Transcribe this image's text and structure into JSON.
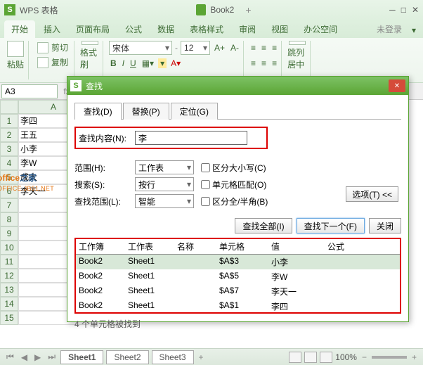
{
  "titlebar": {
    "title": "WPS 表格",
    "doc": "Book2",
    "plus": "+"
  },
  "menus": {
    "items": [
      "开始",
      "插入",
      "页面布局",
      "公式",
      "数据",
      "表格样式",
      "审阅",
      "视图",
      "办公空间"
    ],
    "login": "未登录",
    "drop": "▾"
  },
  "ribbon": {
    "cut": "剪切",
    "copy": "复制",
    "paste": "粘贴",
    "fmt": "格式刷",
    "font": "宋体",
    "size": "12",
    "aplus": "A+",
    "aminus": "A-",
    "fill": "跳列居中"
  },
  "cellref": "A3",
  "colA": "A",
  "cells": [
    "李四",
    "王五",
    "小李",
    "李W",
    "成大",
    "李天一",
    "",
    "",
    "",
    "",
    "",
    "",
    "",
    "",
    ""
  ],
  "watermark": {
    "t1": "office",
    "t2": "之家",
    "t3": "OFFICE.JB51.NET"
  },
  "dialog": {
    "title": "查找",
    "tabs": [
      "查找(D)",
      "替换(P)",
      "定位(G)"
    ],
    "content_label": "查找内容(N):",
    "content_value": "李",
    "scope_label": "范围(H):",
    "scope_value": "工作表",
    "chk_case": "区分大小写(C)",
    "search_label": "搜索(S):",
    "search_value": "按行",
    "chk_whole": "单元格匹配(O)",
    "look_label": "查找范围(L):",
    "look_value": "智能",
    "chk_half": "区分全/半角(B)",
    "options_btn": "选项(T) <<",
    "find_all": "查找全部(I)",
    "find_next": "查找下一个(F)",
    "close": "关闭",
    "hdr": {
      "wb": "工作簿",
      "ws": "工作表",
      "nm": "名称",
      "cl": "单元格",
      "vl": "值",
      "fm": "公式"
    },
    "rows": [
      {
        "wb": "Book2",
        "ws": "Sheet1",
        "nm": "",
        "cl": "$A$3",
        "vl": "小李",
        "fm": ""
      },
      {
        "wb": "Book2",
        "ws": "Sheet1",
        "nm": "",
        "cl": "$A$5",
        "vl": "李W",
        "fm": ""
      },
      {
        "wb": "Book2",
        "ws": "Sheet1",
        "nm": "",
        "cl": "$A$7",
        "vl": "李天一",
        "fm": ""
      },
      {
        "wb": "Book2",
        "ws": "Sheet1",
        "nm": "",
        "cl": "$A$1",
        "vl": "李四",
        "fm": ""
      }
    ],
    "status": "4 个单元格被找到"
  },
  "status": {
    "sheets": [
      "Sheet1",
      "Sheet2",
      "Sheet3"
    ],
    "zoom": "100%",
    "plus": "+",
    "minus": "−"
  }
}
